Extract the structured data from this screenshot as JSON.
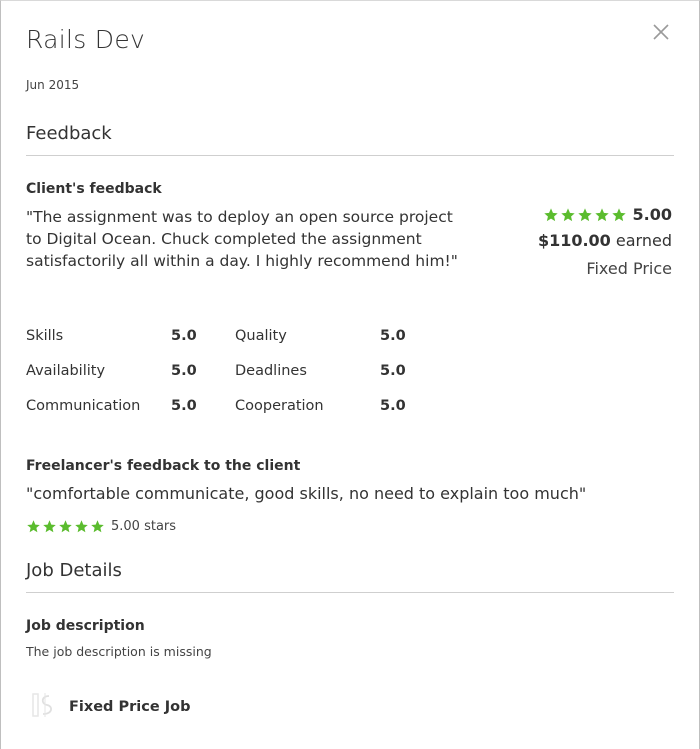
{
  "header": {
    "title": "Rails Dev",
    "date": "Jun 2015"
  },
  "feedback": {
    "heading": "Feedback",
    "client_label": "Client's feedback",
    "client_quote": "\"The assignment was to deploy an open source project to Digital Ocean. Chuck completed the assignment satisfactorily all within a day. I highly recommend him!\"",
    "rating": "5.00",
    "rating_value": 5,
    "amount": "$110.00",
    "earned_label": "earned",
    "contract_type": "Fixed Price",
    "ratings": [
      {
        "label": "Skills",
        "value": "5.0"
      },
      {
        "label": "Quality",
        "value": "5.0"
      },
      {
        "label": "Availability",
        "value": "5.0"
      },
      {
        "label": "Deadlines",
        "value": "5.0"
      },
      {
        "label": "Communication",
        "value": "5.0"
      },
      {
        "label": "Cooperation",
        "value": "5.0"
      }
    ],
    "freelancer_label": "Freelancer's feedback to the client",
    "freelancer_quote": "\"comfortable communicate, good skills, no need to explain too much\"",
    "freelancer_stars_text": "5.00 stars",
    "freelancer_rating_value": 5
  },
  "job": {
    "heading": "Job Details",
    "desc_label": "Job description",
    "desc_text": "The job description is missing",
    "type_label": "Fixed Price Job",
    "type_icon": "fixed-price-icon"
  },
  "colors": {
    "star": "#5bbc2e",
    "text": "#333333",
    "rule": "#cfcfcf"
  },
  "icons": {
    "close": "close-icon",
    "star": "star-icon"
  }
}
